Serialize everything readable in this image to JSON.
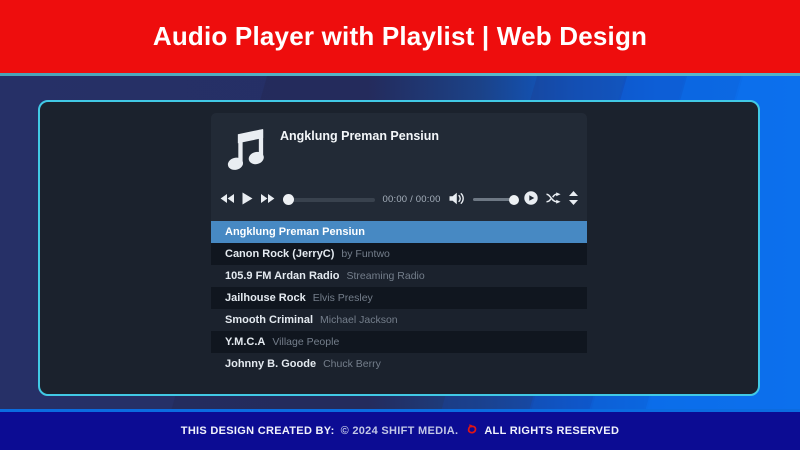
{
  "header": {
    "title": "Audio Player with Playlist | Web Design"
  },
  "player": {
    "now_playing": "Angklung Preman Pensiun",
    "time_display": "00:00 / 00:00",
    "progress_percent": 0,
    "volume_percent": 85
  },
  "playlist": [
    {
      "title": "Angklung Preman Pensiun",
      "artist": "",
      "active": true
    },
    {
      "title": "Canon Rock (JerryC)",
      "artist": "by Funtwo",
      "active": false
    },
    {
      "title": "105.9 FM Ardan Radio",
      "artist": "Streaming Radio",
      "active": false
    },
    {
      "title": "Jailhouse Rock",
      "artist": "Elvis Presley",
      "active": false
    },
    {
      "title": "Smooth Criminal",
      "artist": "Michael Jackson",
      "active": false
    },
    {
      "title": "Y.M.C.A",
      "artist": "Village People",
      "active": false
    },
    {
      "title": "Johnny B. Goode",
      "artist": "Chuck Berry",
      "active": false
    }
  ],
  "footer": {
    "created_by": "THIS DESIGN CREATED BY:",
    "copyright": "© 2024 SHIFT MEDIA.",
    "rights": "ALL RIGHTS RESERVED"
  },
  "icons": {
    "music_note": "beamed-eighth-notes",
    "previous": "double-left-triangles",
    "play": "right-triangle",
    "next": "double-right-triangles",
    "volume": "speaker-with-waves",
    "play_circle": "play-in-circle",
    "shuffle": "crossed-arrows",
    "scroll": "up-down-triangles",
    "footer_logo": "red-swirl"
  },
  "colors": {
    "header_red": "#ee0d0d",
    "border_cyan": "#41c9e5",
    "panel_dark": "#1b222d",
    "card_dark": "#222a36",
    "row_dark": "#10161f",
    "row_light": "#1b222d",
    "active_row_blue": "#4789c3",
    "footer_navy": "#0c0c93",
    "footer_line_blue": "#0b6ce0",
    "bg_left_navy": "#252c5e",
    "bg_right_blue": "#0d72f0",
    "logo_red": "#e01515"
  }
}
